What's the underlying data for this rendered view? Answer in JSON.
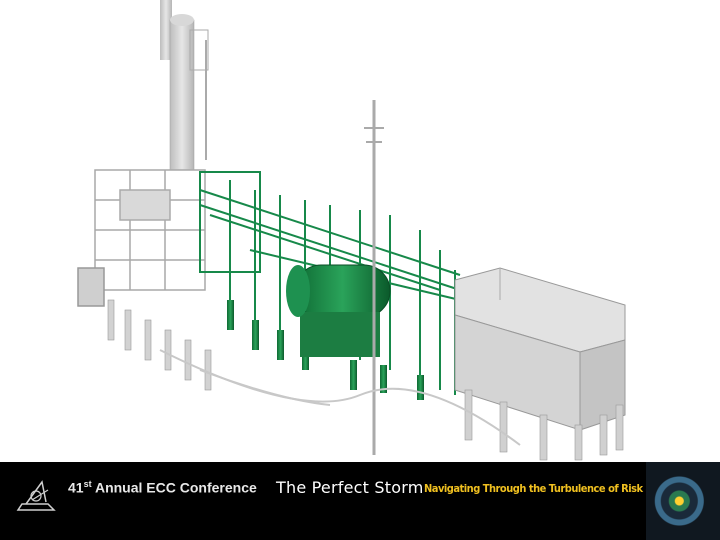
{
  "footer": {
    "conference_number": "41",
    "conference_suffix": "st",
    "conference_name": "Annual ECC Conference",
    "theme": "The Perfect Storm",
    "tagline": "Navigating Through the Turbulence of Risk and Change"
  },
  "colors": {
    "highlight_green": "#1f8f4a",
    "equipment_gray": "#d4d4d4",
    "tagline_yellow": "#f0c020"
  },
  "icons": {
    "logo": "sailboat-logo-icon"
  }
}
